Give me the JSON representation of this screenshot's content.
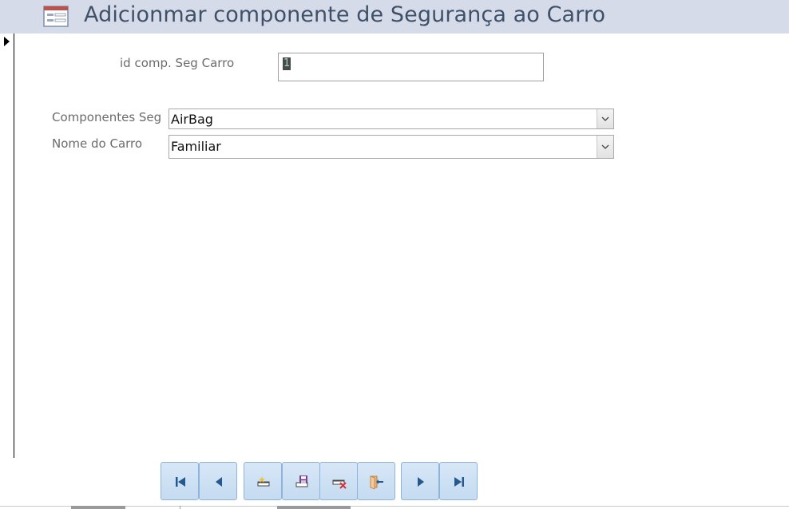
{
  "form": {
    "title": "Adicionmar componente de Segurança ao Carro",
    "fields": {
      "id_label": "id comp. Seg Carro",
      "id_value": "1",
      "componentes_label": "Componentes Seg",
      "componentes_value": "AirBag",
      "nome_label": "Nome do Carro",
      "nome_value": "Familiar"
    }
  },
  "nav_buttons": [
    {
      "icon": "first-record-icon"
    },
    {
      "icon": "previous-record-icon"
    },
    {
      "icon": "new-record-icon"
    },
    {
      "icon": "save-record-icon"
    },
    {
      "icon": "delete-record-icon"
    },
    {
      "icon": "close-form-icon"
    },
    {
      "icon": "next-record-icon"
    },
    {
      "icon": "last-record-icon"
    }
  ],
  "colors": {
    "header_bg": "#d6dbe9",
    "title_text": "#3e5168",
    "button_bg": "#c5dbf1",
    "button_border": "#8fb4dc",
    "label_text": "#6b6b6b"
  }
}
